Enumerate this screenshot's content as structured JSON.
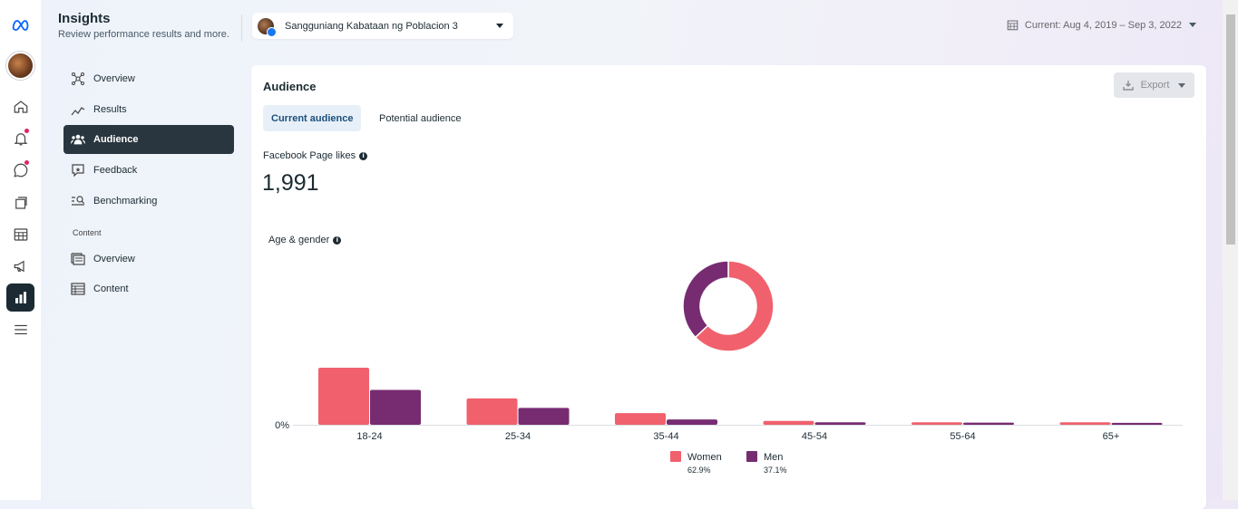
{
  "app": {
    "title": "Insights",
    "subtitle": "Review performance results and more."
  },
  "page_selector": {
    "name": "Sangguniang Kabataan ng Poblacion 3"
  },
  "date_range": {
    "label": "Current: Aug 4, 2019 – Sep 3, 2022"
  },
  "rail": {
    "icons": [
      "meta-logo-icon",
      "home-icon",
      "notifications-icon",
      "messages-icon",
      "pages-icon",
      "table-icon",
      "ads-megaphone-icon",
      "insights-icon",
      "menu-icon"
    ],
    "active": "insights-icon"
  },
  "sidebar": {
    "items": [
      {
        "label": "Overview",
        "icon": "overview-icon"
      },
      {
        "label": "Results",
        "icon": "results-icon"
      },
      {
        "label": "Audience",
        "icon": "audience-icon",
        "active": true
      },
      {
        "label": "Feedback",
        "icon": "feedback-icon"
      },
      {
        "label": "Benchmarking",
        "icon": "benchmarking-icon"
      }
    ],
    "content_section": "Content",
    "content_items": [
      {
        "label": "Overview",
        "icon": "content-overview-icon"
      },
      {
        "label": "Content",
        "icon": "content-table-icon"
      }
    ]
  },
  "main": {
    "card_title": "Audience",
    "export_label": "Export",
    "tabs": [
      {
        "label": "Current audience",
        "active": true
      },
      {
        "label": "Potential audience",
        "active": false
      }
    ],
    "page_likes_label": "Facebook Page likes",
    "page_likes_value": "1,991",
    "age_gender_label": "Age & gender"
  },
  "chart_data": {
    "type": "bar",
    "categories": [
      "18-24",
      "25-34",
      "35-44",
      "45-54",
      "55-64",
      "65+"
    ],
    "y_tick_labels": [
      "0%"
    ],
    "series": [
      {
        "name": "Women",
        "color": "#f0616d",
        "values": [
          27,
          12.5,
          5.5,
          1.8,
          1.2,
          1.2
        ]
      },
      {
        "name": "Men",
        "color": "#772c72",
        "values": [
          16.5,
          8,
          2.5,
          1.2,
          1.0,
          0.9
        ]
      }
    ],
    "ylim": [
      0,
      30
    ],
    "legend": [
      {
        "name": "Women",
        "percent": "62.9%"
      },
      {
        "name": "Men",
        "percent": "37.1%"
      }
    ],
    "donut": {
      "Women": 62.9,
      "Men": 37.1
    },
    "legend_position": "bottom-center"
  }
}
